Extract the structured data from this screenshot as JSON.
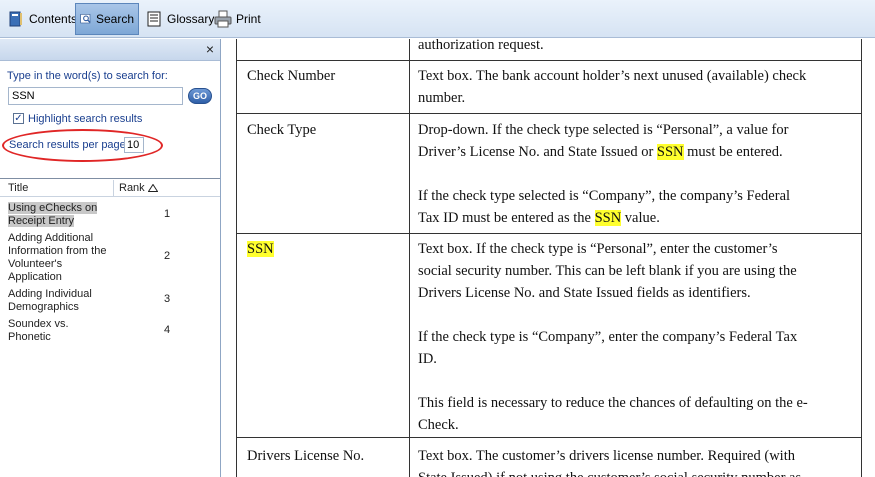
{
  "toolbar": {
    "contents_label": "Contents",
    "search_label": "Search",
    "glossary_label": "Glossary",
    "print_label": "Print"
  },
  "left_pane": {
    "close_symbol": "×",
    "search_prompt": "Type in the word(s) to search for:",
    "search_value": "SSN",
    "go_label": "GO",
    "highlight_label": "Highlight search results",
    "highlight_checked": true,
    "per_page_label": "Search results per page",
    "per_page_value": "10",
    "results_columns": {
      "title": "Title",
      "rank": "Rank"
    },
    "results": [
      {
        "title": "Using eChecks on Receipt Entry",
        "rank": "1",
        "selected": true
      },
      {
        "title": "Adding Additional Information from the Volunteer's Application",
        "rank": "2",
        "selected": false
      },
      {
        "title": "Adding Individual Demographics",
        "rank": "3",
        "selected": false
      },
      {
        "title": "Soundex vs. Phonetic",
        "rank": "4",
        "selected": false
      }
    ]
  },
  "document": {
    "top_partial": "authorization request.",
    "rows": [
      {
        "field": "Check Number",
        "desc_lines": [
          "Text box. The bank account holder’s next unused (available) check",
          "number."
        ]
      },
      {
        "field": "Check Type",
        "desc_lines_a": [
          "Drop-down. If the check type selected is “Personal”, a value for",
          "Driver’s License No. and State Issued or ",
          "SSN",
          " must be entered."
        ],
        "desc_lines_b": [
          "If the check type selected is “Company”, the company’s Federal",
          "Tax ID must be entered as the ",
          "SSN",
          " value."
        ]
      },
      {
        "field": "SSN",
        "desc_p1": [
          "Text box. If the check type is “Personal”, enter the customer’s",
          "social security number. This can be left blank if you are using the",
          "Drivers License No. and State Issued fields as identifiers."
        ],
        "desc_p2": [
          "If the check type is “Company”, enter the company’s Federal Tax",
          "ID."
        ],
        "desc_p3": [
          "This field is necessary to reduce the chances of defaulting on the e-",
          "Check."
        ]
      },
      {
        "field": "Drivers License No.",
        "desc_lines": [
          "Text box. The customer’s drivers license number. Required (with",
          "State Issued) if not using the customer’s social security number as"
        ]
      }
    ]
  },
  "colors": {
    "highlight": "#ffff2e",
    "annotation_circle": "#e02626",
    "label_blue": "#1a3f8f"
  }
}
